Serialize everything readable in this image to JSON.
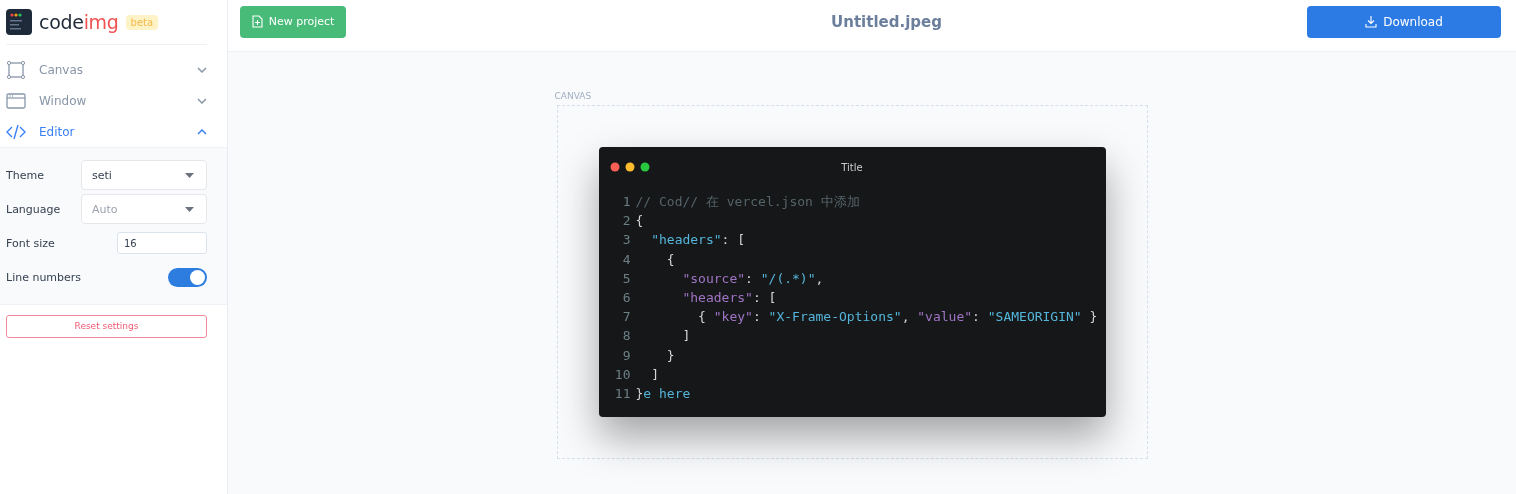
{
  "logo": {
    "text_main": "code",
    "text_accent": "img",
    "badge": "beta"
  },
  "sidebar": {
    "sections": [
      {
        "label": "Canvas",
        "expanded": false
      },
      {
        "label": "Window",
        "expanded": false
      },
      {
        "label": "Editor",
        "expanded": true
      }
    ],
    "settings": [
      {
        "kind": "select",
        "label": "Theme",
        "value": "seti"
      },
      {
        "kind": "select",
        "label": "Language",
        "placeholder": "Auto"
      },
      {
        "kind": "input",
        "label": "Font size",
        "value": "16"
      },
      {
        "kind": "toggle",
        "label": "Line numbers",
        "on": true
      }
    ],
    "reset_button": "Reset settings"
  },
  "header": {
    "new_button": "New project",
    "file_name": "Untitled.jpeg",
    "download_button": "Download"
  },
  "canvas": {
    "label": "CANVAS",
    "window": {
      "title": "Title",
      "lines": [
        {
          "number": "1",
          "tokens": [
            {
              "kind": "comment",
              "text": "// Cod// 在 vercel.json 中添加"
            }
          ]
        },
        {
          "number": "2",
          "tokens": [
            {
              "kind": "punct",
              "text": "{"
            }
          ]
        },
        {
          "number": "3",
          "tokens": [
            {
              "kind": "key3",
              "text": "  \"headers\""
            },
            {
              "kind": "punct",
              "text": ": ["
            }
          ]
        },
        {
          "number": "4",
          "tokens": [
            {
              "kind": "punct",
              "text": "    {"
            }
          ]
        },
        {
          "number": "5",
          "tokens": [
            {
              "kind": "key",
              "text": "      \"source\""
            },
            {
              "kind": "punct",
              "text": ": "
            },
            {
              "kind": "string",
              "text": "\"/(.*)\""
            },
            {
              "kind": "punct",
              "text": ","
            }
          ]
        },
        {
          "number": "6",
          "tokens": [
            {
              "kind": "key",
              "text": "      \"headers\""
            },
            {
              "kind": "punct",
              "text": ": ["
            }
          ]
        },
        {
          "number": "7",
          "tokens": [
            {
              "kind": "punct",
              "text": "        { "
            },
            {
              "kind": "key",
              "text": "\"key\""
            },
            {
              "kind": "punct",
              "text": ": "
            },
            {
              "kind": "string",
              "text": "\"X-Frame-Options\""
            },
            {
              "kind": "punct",
              "text": ", "
            },
            {
              "kind": "key",
              "text": "\"value\""
            },
            {
              "kind": "punct",
              "text": ": "
            },
            {
              "kind": "string",
              "text": "\"SAMEORIGIN\""
            },
            {
              "kind": "punct",
              "text": " }"
            }
          ]
        },
        {
          "number": "8",
          "tokens": [
            {
              "kind": "punct",
              "text": "      ]"
            }
          ]
        },
        {
          "number": "9",
          "tokens": [
            {
              "kind": "punct",
              "text": "    }"
            }
          ]
        },
        {
          "number": "10",
          "tokens": [
            {
              "kind": "punct",
              "text": "  ]"
            }
          ]
        },
        {
          "number": "11",
          "tokens": [
            {
              "kind": "punct",
              "text": "}"
            },
            {
              "kind": "string",
              "text": "e here"
            }
          ]
        }
      ]
    }
  }
}
